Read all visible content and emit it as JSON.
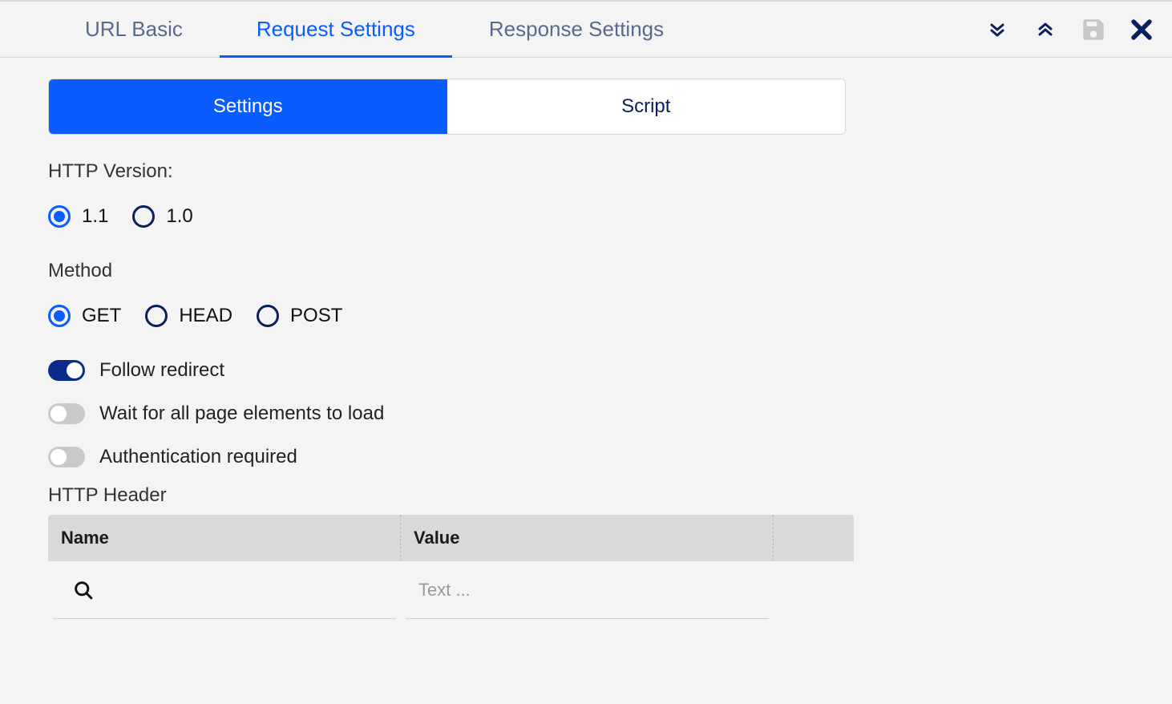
{
  "tabs": {
    "url_basic": "URL Basic",
    "request_settings": "Request Settings",
    "response_settings": "Response Settings",
    "active": "request_settings"
  },
  "segmented": {
    "settings": "Settings",
    "script": "Script",
    "active": "settings"
  },
  "httpVersion": {
    "label": "HTTP Version:",
    "options": [
      "1.1",
      "1.0"
    ],
    "selected": "1.1"
  },
  "method": {
    "label": "Method",
    "options": [
      "GET",
      "HEAD",
      "POST"
    ],
    "selected": "GET"
  },
  "toggles": {
    "follow_redirect": {
      "label": "Follow redirect",
      "on": true
    },
    "wait_elements": {
      "label": "Wait for all page elements to load",
      "on": false
    },
    "auth_required": {
      "label": "Authentication required",
      "on": false
    }
  },
  "httpHeader": {
    "label": "HTTP Header",
    "columns": {
      "name": "Name",
      "value": "Value"
    },
    "row": {
      "name_value": "",
      "value_placeholder": "Text ..."
    }
  },
  "colors": {
    "accent": "#0a5cff",
    "navy": "#0b1f5c"
  }
}
